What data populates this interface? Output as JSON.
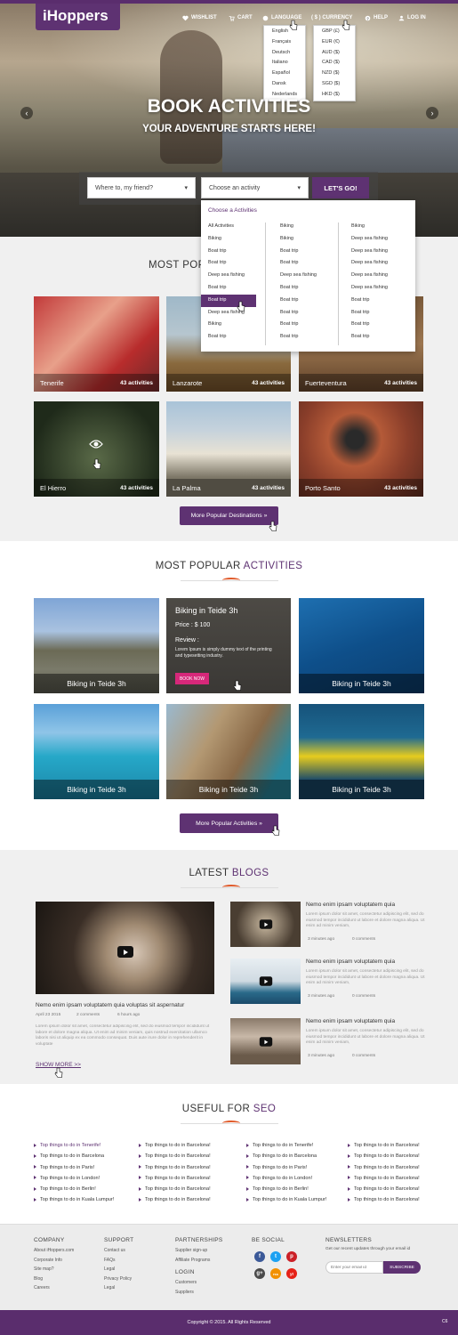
{
  "brand": {
    "logo": "iHoppers",
    "accent": "#5e3272"
  },
  "nav": {
    "wishlist": "WISHLIST",
    "cart": "CART",
    "language": "LANGUAGE",
    "currency": "( $ ) CURRENCY",
    "help": "HELP",
    "login": "LOG IN"
  },
  "language_menu": [
    "English",
    "Français",
    "Deutsch",
    "Italiano",
    "Español",
    "Dansk",
    "Nederlands"
  ],
  "currency_menu": [
    "GBP (£)",
    "EUR (€)",
    "AUD ($)",
    "CAD ($)",
    "NZD ($)",
    "SGD ($)",
    "HKD ($)"
  ],
  "hero": {
    "title": "BOOK ACTIVITIES",
    "subtitle": "YOUR ADVENTURE STARTS HERE!"
  },
  "search": {
    "where_placeholder": "Where to, my friend?",
    "activity_placeholder": "Choose an activity",
    "go_label": "LET'S GO!"
  },
  "activity_dropdown": {
    "heading": "Choose a Activities",
    "col1": [
      "All Activities",
      "Biking",
      "Boat trip",
      "Boat trip",
      "Deep sea fishing",
      "Boat trip",
      "Boat trip",
      "Deep sea fishing",
      "Biking",
      "Boat trip"
    ],
    "col1_highlight_index": 6,
    "col2": [
      "Biking",
      "Biking",
      "Boat trip",
      "Boat trip",
      "Deep sea fishing",
      "Boat trip",
      "Boat trip",
      "Boat trip",
      "Boat trip",
      "Boat trip"
    ],
    "col3": [
      "Biking",
      "Deep sea fishing",
      "Deep sea fishing",
      "Deep sea fishing",
      "Deep sea fishing",
      "Deep sea fishing",
      "Boat trip",
      "Boat trip",
      "Boat trip",
      "Boat trip"
    ]
  },
  "destinations": {
    "title_partial": "MOST POP",
    "items": [
      {
        "name": "Tenerife",
        "count": "43 activities"
      },
      {
        "name": "Lanzarote",
        "count": "43 activities"
      },
      {
        "name": "Fuerteventura",
        "count": "43 activities"
      },
      {
        "name": "El Hierro",
        "count": "43 activities"
      },
      {
        "name": "La Palma",
        "count": "43 activities"
      },
      {
        "name": "Porto Santo",
        "count": "43 activities"
      }
    ],
    "more_label": "More Popular Destinations »"
  },
  "activities": {
    "title_main": "MOST POPULAR ",
    "title_accent": "ACTIVITIES",
    "items": [
      "Biking in Teide 3h",
      "Biking in Teide 3h",
      "Biking in Teide 3h",
      "Biking in Teide 3h",
      "Biking in Teide 3h",
      "Biking in Teide 3h"
    ],
    "hover": {
      "title": "Biking in Teide 3h",
      "price": "Price : $ 100",
      "review_label": "Review :",
      "review_text": "Lorem Ipsum is simply dummy text of the printing and typesetting industry.",
      "book_label": "BOOK NOW"
    },
    "more_label": "More Popular Activities »"
  },
  "blogs": {
    "title_main": "LATEST ",
    "title_accent": "BLOGS",
    "featured": {
      "title": "Nemo enim ipsam voluptatem quia voluptas sit aspernatur",
      "date": "April 23 2015",
      "comments": "2 comments",
      "ago": "6 hours ago",
      "text": "Lorem ipsum dolor sit amet, consectetur adipiscing elit, sed do eiusmod tempor incididunt ut labore et dolore magna aliqua. Ut enim ad minim veniam, quis nostrud exercitation ullamco laboris nisi ut aliquip ex ea commodo consequat. Duis aute irure dolor in reprehenderit in voluptate",
      "more": "SHOW MORE >>"
    },
    "side": [
      {
        "title": "Nemo enim ipsam voluptatem quia",
        "text": "Lorem ipsum dolor sit amet, consectetur adipiscing elit, sed do eiusmod tempor incididunt ut labore et dolore magna aliqua. Ut enim ad minim veniam,",
        "ago": "3 minutes ago",
        "comments": "0 comments"
      },
      {
        "title": "Nemo enim ipsam voluptatem quia",
        "text": "Lorem ipsum dolor sit amet, consectetur adipiscing elit, sed do eiusmod tempor incididunt ut labore et dolore magna aliqua. Ut enim ad minim veniam,",
        "ago": "3 minutes ago",
        "comments": "0 comments"
      },
      {
        "title": "Nemo enim ipsam voluptatem quia",
        "text": "Lorem ipsum dolor sit amet, consectetur adipiscing elit, sed do eiusmod tempor incididunt ut labore et dolore magna aliqua. Ut enim ad minim veniam,",
        "ago": "3 minutes ago",
        "comments": "0 comments"
      }
    ]
  },
  "seo": {
    "title_main": "USEFUL FOR ",
    "title_accent": "SEO",
    "columns": [
      [
        "Top things to do in Tenerife!",
        "Top things to do in Barcelona",
        "Top things to do in Paris!",
        "Top things to do in London!",
        "Top things to do in Berlin!",
        "Top things to do in Kuala Lumpur!"
      ],
      [
        "Top things to do in Barcelona!",
        "Top things to do in Barcelona!",
        "Top things to do in Barcelona!",
        "Top things to do in Barcelona!",
        "Top things to do in Barcelona!",
        "Top things to do in Barcelona!"
      ],
      [
        "Top things to do in Tenerife!",
        "Top things to do in Barcelona",
        "Top things to do in Paris!",
        "Top things to do in London!",
        "Top things to do in Berlin!",
        "Top things to do in Kuala Lumpur!"
      ],
      [
        "Top things to do in Barcelona!",
        "Top things to do in Barcelona!",
        "Top things to do in Barcelona!",
        "Top things to do in Barcelona!",
        "Top things to do in Barcelona!",
        "Top things to do in Barcelona!"
      ]
    ]
  },
  "footer": {
    "company": {
      "heading": "COMPANY",
      "links": [
        "About iHoppers.com",
        "Corporate Info",
        "Site map?",
        "Blog",
        "Careers"
      ]
    },
    "support": {
      "heading": "SUPPORT",
      "links": [
        "Contact us",
        "FAQs",
        "Legal",
        "Privacy Policy",
        "Legal"
      ]
    },
    "partnerships": {
      "heading": "PARTNERSHIPS",
      "links": [
        "Supplier sign-up",
        "Affiliate Programs"
      ]
    },
    "login": {
      "heading": "LOGIN",
      "links": [
        "Customers",
        "Suppliers"
      ]
    },
    "social": {
      "heading": "BE SOCIAL",
      "icons": [
        "f",
        "t",
        "p",
        "g+",
        "rss",
        "yt"
      ]
    },
    "newsletter": {
      "heading": "NEWSLETTERS",
      "text": "Get our recent updates through your email id",
      "placeholder": "Enter your email id",
      "button": "SUBSCRIBE"
    },
    "copyright": "Copyright © 2015. All Rights Reserved",
    "corner": "C6"
  }
}
